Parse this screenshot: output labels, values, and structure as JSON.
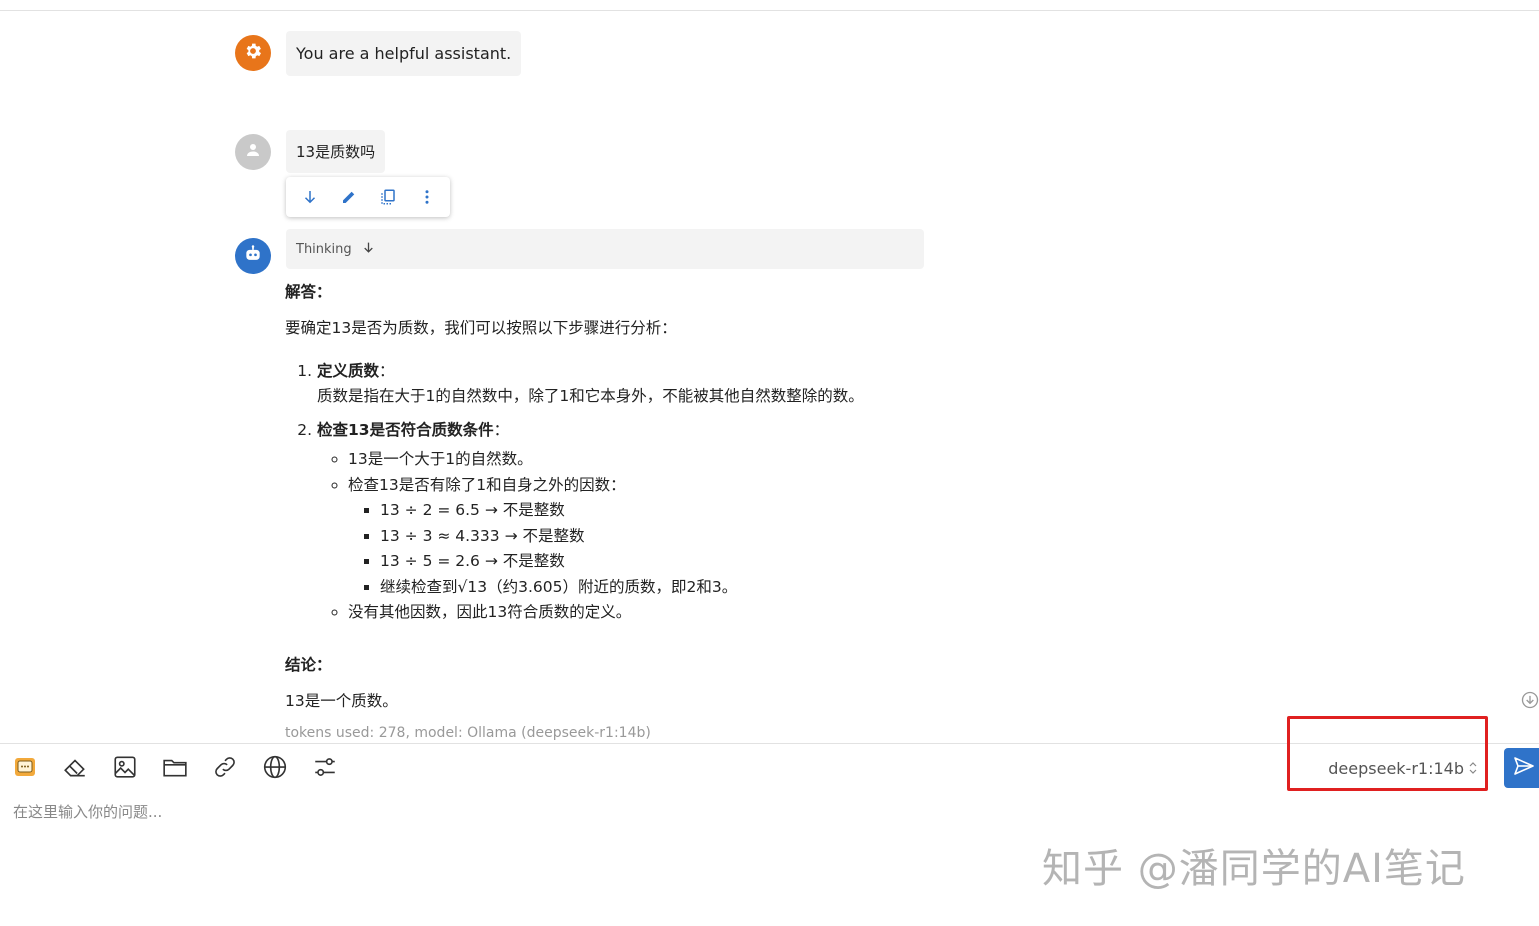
{
  "messages": {
    "system": {
      "avatar_icon": "gear-icon",
      "text": "You are a helpful assistant."
    },
    "user": {
      "avatar_icon": "person-icon",
      "text": "13是质数吗"
    },
    "assistant": {
      "avatar_icon": "robot-icon",
      "thinking_label": "Thinking",
      "answer": {
        "heading": "解答：",
        "intro": "要确定13是否为质数，我们可以按照以下步骤进行分析：",
        "steps": [
          {
            "title": "定义质数",
            "sep": "：",
            "body": "质数是指在大于1的自然数中，除了1和它本身外，不能被其他自然数整除的数。"
          },
          {
            "title": "检查13是否符合质数条件",
            "sep": "："
          }
        ],
        "checks": {
          "item1": "13是一个大于1的自然数。",
          "item2": "检查13是否有除了1和自身之外的因数：",
          "divisions": [
            "13 ÷ 2 = 6.5 → 不是整数",
            "13 ÷ 3 ≈ 4.333 → 不是整数",
            "13 ÷ 5 = 2.6 → 不是整数",
            "继续检查到√13（约3.605）附近的质数，即2和3。"
          ],
          "item3": "没有其他因数，因此13符合质数的定义。"
        },
        "conclusion_heading": "结论：",
        "conclusion": "13是一个质数。"
      },
      "meta": "tokens used: 278, model: Ollama (deepseek-r1:14b)"
    }
  },
  "message_toolbar": [
    "arrow-down-icon",
    "edit-icon",
    "copy-icon",
    "more-vertical-icon"
  ],
  "input_toolbar": [
    "chat-icon",
    "eraser-icon",
    "image-icon",
    "folder-icon",
    "link-icon",
    "globe-icon",
    "settings-sliders-icon"
  ],
  "model_selector": {
    "value": "deepseek-r1:14b"
  },
  "input": {
    "placeholder": "在这里输入你的问题..."
  },
  "watermark": "知乎 @潘同学的AI笔记",
  "colors": {
    "accent": "#2f73c9",
    "system_avatar": "#e8751a",
    "highlight": "#e02020"
  }
}
